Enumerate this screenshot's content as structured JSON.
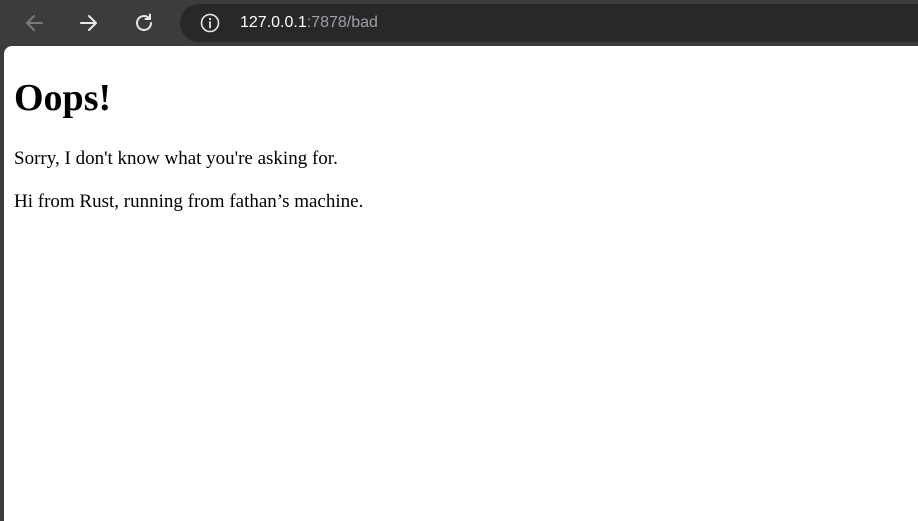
{
  "browser": {
    "back_icon": "arrow-left-icon",
    "forward_icon": "arrow-right-icon",
    "reload_icon": "reload-icon",
    "site_info_icon": "info-icon",
    "url_host": "127.0.0.1",
    "url_rest": ":7878/bad",
    "colors": {
      "chrome_bg": "#3c3c3c",
      "omnibox_bg": "#282828",
      "url_host": "#ffffff",
      "url_path": "#9aa0a6",
      "page_bg": "#ffffff"
    }
  },
  "page": {
    "heading": "Oops!",
    "message": "Sorry, I don't know what you're asking for.",
    "footer": "Hi from Rust, running from fathan’s machine."
  }
}
